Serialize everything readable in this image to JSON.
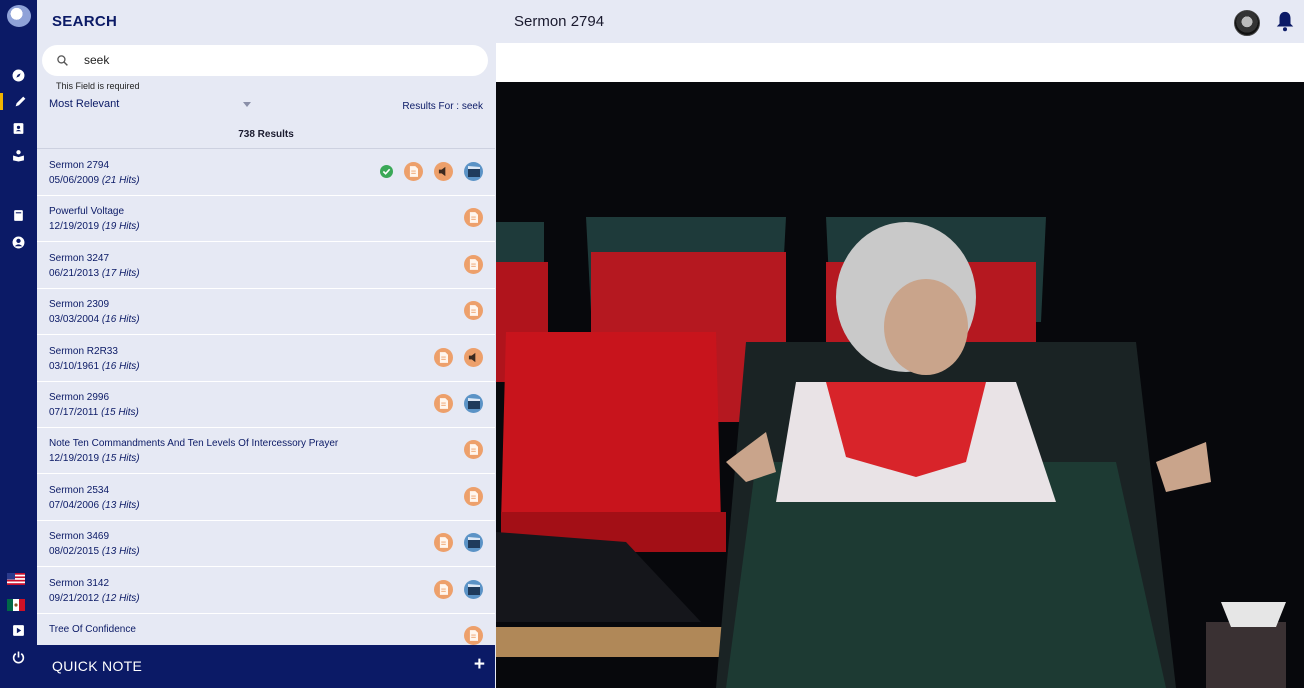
{
  "header": {
    "section_title": "SEARCH",
    "page_title": "Sermon 2794"
  },
  "search": {
    "value": "seek",
    "helper": "This Field is required",
    "sort_label": "Most Relevant",
    "results_for": "Results For : seek",
    "count": "738 Results"
  },
  "results": [
    {
      "title": "Sermon 2794",
      "date": "05/06/2009",
      "hits": "(21 Hits)",
      "icons": [
        "check",
        "doc",
        "audio",
        "video"
      ]
    },
    {
      "title": "Powerful Voltage",
      "date": "12/19/2019",
      "hits": "(19 Hits)",
      "icons": [
        "doc"
      ]
    },
    {
      "title": "Sermon 3247",
      "date": "06/21/2013",
      "hits": "(17 Hits)",
      "icons": [
        "doc"
      ]
    },
    {
      "title": "Sermon 2309",
      "date": "03/03/2004",
      "hits": "(16 Hits)",
      "icons": [
        "doc"
      ]
    },
    {
      "title": "Sermon R2R33",
      "date": "03/10/1961",
      "hits": "(16 Hits)",
      "icons": [
        "doc",
        "audio"
      ]
    },
    {
      "title": "Sermon 2996",
      "date": "07/17/2011",
      "hits": "(15 Hits)",
      "icons": [
        "doc",
        "video"
      ]
    },
    {
      "title": "Note Ten Commandments And Ten Levels Of Intercessory Prayer",
      "date": "12/19/2019",
      "hits": "(15 Hits)",
      "icons": [
        "doc"
      ]
    },
    {
      "title": "Sermon 2534",
      "date": "07/04/2006",
      "hits": "(13 Hits)",
      "icons": [
        "doc"
      ]
    },
    {
      "title": "Sermon 3469",
      "date": "08/02/2015",
      "hits": "(13 Hits)",
      "icons": [
        "doc",
        "video"
      ]
    },
    {
      "title": "Sermon 3142",
      "date": "09/21/2012",
      "hits": "(12 Hits)",
      "icons": [
        "doc",
        "video"
      ]
    },
    {
      "title": "Tree Of Confidence",
      "date": "",
      "hits": "",
      "icons": [
        "doc"
      ]
    }
  ],
  "quick_note": {
    "label": "QUICK NOTE",
    "add": "+"
  },
  "colors": {
    "navy": "#0b1a66",
    "panel": "#e6e9f4",
    "doc_orange": "#eda06b",
    "video_blue": "#5b93c6",
    "check_green": "#3aa857"
  },
  "rail_icons": [
    "compass-icon",
    "pen-icon",
    "contact-book-icon",
    "reader-icon",
    "book-icon",
    "account-icon",
    "flag-us-icon",
    "flag-mx-icon",
    "play-box-icon",
    "power-icon"
  ]
}
